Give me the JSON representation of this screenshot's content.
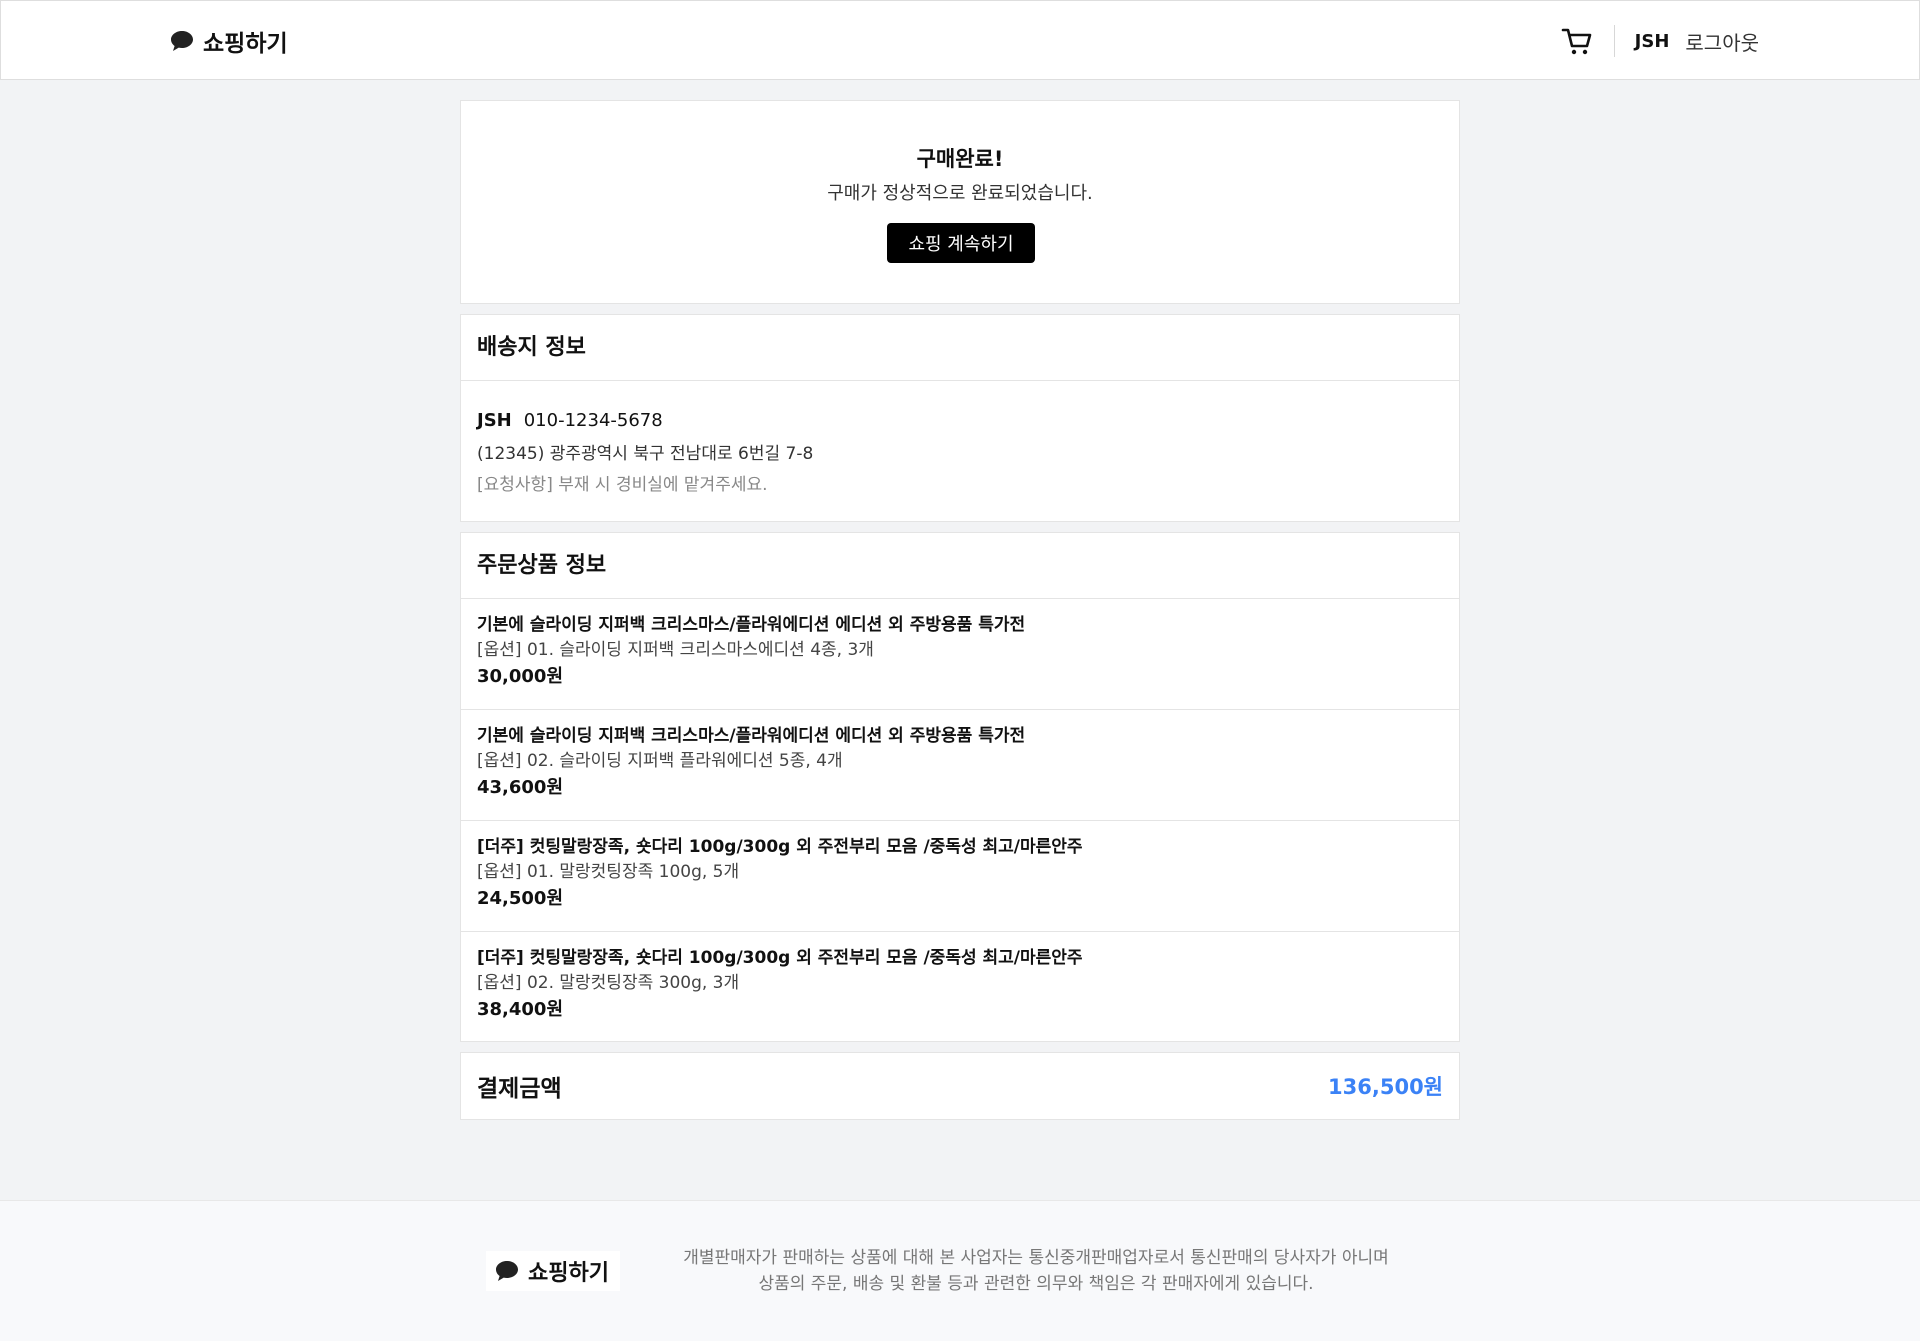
{
  "header": {
    "logo_text": "쇼핑하기",
    "user": "JSH",
    "logout_label": "로그아웃"
  },
  "complete": {
    "title": "구매완료!",
    "description": "구매가 정상적으로 완료되었습니다.",
    "button_label": "쇼핑 계속하기"
  },
  "shipping": {
    "title": "배송지 정보",
    "name": "JSH",
    "phone": "010-1234-5678",
    "address": "(12345) 광주광역시 북구 전남대로 6번길 7-8",
    "request": "[요청사항] 부재 시 경비실에 맡겨주세요."
  },
  "order": {
    "title": "주문상품 정보",
    "items": [
      {
        "name": "기본에 슬라이딩 지퍼백 크리스마스/플라워에디션 에디션 외 주방용품 특가전",
        "option": "[옵션] 01. 슬라이딩 지퍼백 크리스마스에디션 4종, 3개",
        "price": "30,000원"
      },
      {
        "name": "기본에 슬라이딩 지퍼백 크리스마스/플라워에디션 에디션 외 주방용품 특가전",
        "option": "[옵션] 02. 슬라이딩 지퍼백 플라워에디션 5종, 4개",
        "price": "43,600원"
      },
      {
        "name": "[더주] 컷팅말랑장족, 숏다리 100g/300g 외 주전부리 모음 /중독성 최고/마른안주",
        "option": "[옵션] 01. 말랑컷팅장족 100g, 5개",
        "price": "24,500원"
      },
      {
        "name": "[더주] 컷팅말랑장족, 숏다리 100g/300g 외 주전부리 모음 /중독성 최고/마른안주",
        "option": "[옵션] 02. 말랑컷팅장족 300g, 3개",
        "price": "38,400원"
      }
    ]
  },
  "payment": {
    "label": "결제금액",
    "amount": "136,500원",
    "amount_color": "#3b82f6"
  },
  "footer": {
    "logo_text": "쇼핑하기",
    "line1": "개별판매자가 판매하는 상품에 대해 본 사업자는 통신중개판매업자로서 통신판매의 당사자가 아니며",
    "line2": "상품의 주문, 배송 및 환불 등과 관련한 의무와 책임은 각 판매자에게 있습니다."
  },
  "icons": {
    "logo": "chat-bubble-icon",
    "cart": "cart-icon"
  }
}
